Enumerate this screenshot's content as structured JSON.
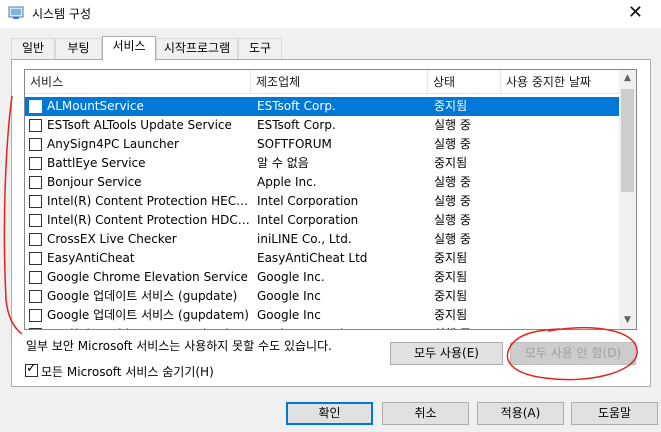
{
  "window": {
    "title": "시스템 구성",
    "close_glyph": "✕"
  },
  "tabs": [
    {
      "label": "일반"
    },
    {
      "label": "부팅"
    },
    {
      "label": "서비스",
      "active": true
    },
    {
      "label": "시작프로그램"
    },
    {
      "label": "도구"
    }
  ],
  "columns": [
    "서비스",
    "제조업체",
    "상태",
    "사용 중지한 날짜"
  ],
  "services": [
    {
      "name": "ALMountService",
      "manufacturer": "ESTsoft Corp.",
      "status": "중지됨",
      "disabled_date": "",
      "checked": false,
      "selected": true
    },
    {
      "name": "ESTsoft ALTools Update Service",
      "manufacturer": "ESTsoft Corp.",
      "status": "실행 중",
      "disabled_date": "",
      "checked": false
    },
    {
      "name": "AnySign4PC Launcher",
      "manufacturer": "SOFTFORUM",
      "status": "실행 중",
      "disabled_date": "",
      "checked": false
    },
    {
      "name": "BattlEye Service",
      "manufacturer": "알 수 없음",
      "status": "중지됨",
      "disabled_date": "",
      "checked": false
    },
    {
      "name": "Bonjour Service",
      "manufacturer": "Apple Inc.",
      "status": "실행 중",
      "disabled_date": "",
      "checked": false
    },
    {
      "name": "Intel(R) Content Protection HECI Se...",
      "manufacturer": "Intel Corporation",
      "status": "실행 중",
      "disabled_date": "",
      "checked": false
    },
    {
      "name": "Intel(R) Content Protection HDCP S...",
      "manufacturer": "Intel Corporation",
      "status": "실행 중",
      "disabled_date": "",
      "checked": false
    },
    {
      "name": "CrossEX Live Checker",
      "manufacturer": "iniLINE Co., Ltd.",
      "status": "실행 중",
      "disabled_date": "",
      "checked": false
    },
    {
      "name": "EasyAntiCheat",
      "manufacturer": "EasyAntiCheat Ltd",
      "status": "중지됨",
      "disabled_date": "",
      "checked": false
    },
    {
      "name": "Google Chrome Elevation Service",
      "manufacturer": "Google Inc.",
      "status": "중지됨",
      "disabled_date": "",
      "checked": false
    },
    {
      "name": "Google 업데이트 서비스 (gupdate)",
      "manufacturer": "Google Inc",
      "status": "중지됨",
      "disabled_date": "",
      "checked": false
    },
    {
      "name": "Google 업데이트 서비스 (gupdatem)",
      "manufacturer": "Google Inc",
      "status": "중지됨",
      "disabled_date": "",
      "checked": false
    },
    {
      "name": "Intel(R) Rapid Storage Technology",
      "manufacturer": "Intel Corporation",
      "status": "실행 중",
      "disabled_date": "",
      "checked": false
    }
  ],
  "note": "일부 보안 Microsoft 서비스는 사용하지 못할 수도 있습니다.",
  "buttons": {
    "enable_all": "모두 사용(E)",
    "disable_all": "모두 사용 안 함(D)",
    "ok": "확인",
    "cancel": "취소",
    "apply": "적용(A)",
    "help": "도움말"
  },
  "hide_ms": {
    "label": "모든 Microsoft 서비스 숨기기(H)",
    "checked": true,
    "mark": "✓"
  },
  "scroll": {
    "up_glyph": "▲",
    "down_glyph": "▼"
  },
  "colors": {
    "selection": "#0078d7",
    "annotation": "#e8231f"
  }
}
